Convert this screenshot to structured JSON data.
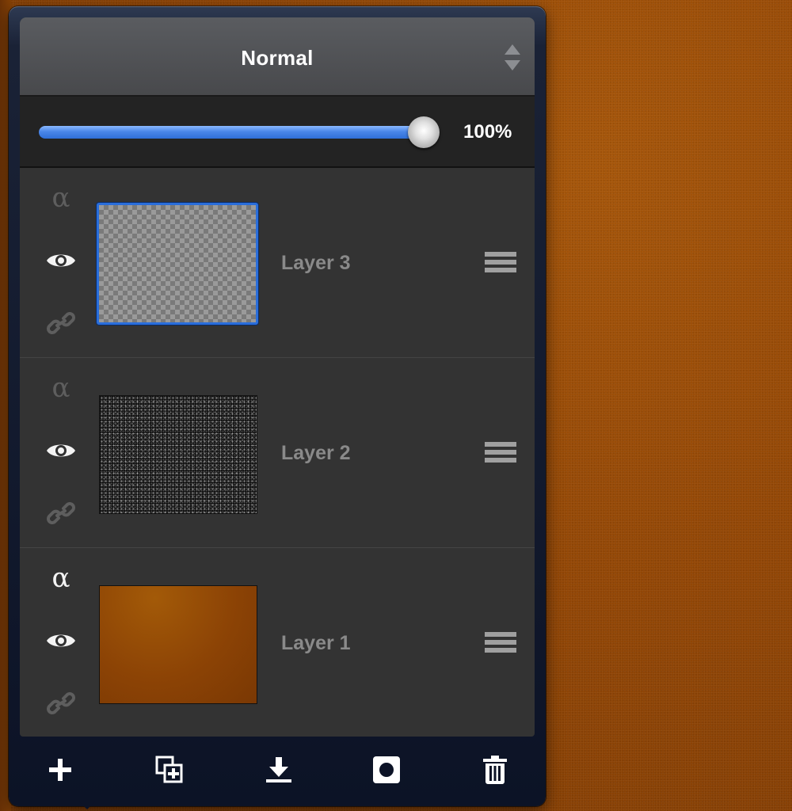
{
  "blend_mode": {
    "label": "Normal"
  },
  "opacity": {
    "value_text": "100%",
    "fraction": 1.0
  },
  "layers": [
    {
      "name": "Layer 3",
      "thumbnail": "transparent-checker",
      "selected": true,
      "alpha_locked": false
    },
    {
      "name": "Layer 2",
      "thumbnail": "noise",
      "selected": false,
      "alpha_locked": false
    },
    {
      "name": "Layer 1",
      "thumbnail": "orange-fill",
      "selected": false,
      "alpha_locked": true
    }
  ],
  "icons": {
    "alpha": "α",
    "visibility": "eye-icon",
    "link": "link-icon",
    "menu": "hamburger-icon"
  },
  "toolbar": {
    "items": [
      "add-layer-icon",
      "duplicate-layer-icon",
      "merge-down-icon",
      "mask-icon",
      "trash-icon"
    ]
  },
  "colors": {
    "accent": "#2f6fd8",
    "selection": "#2a6edb",
    "canvas": "#934706"
  }
}
